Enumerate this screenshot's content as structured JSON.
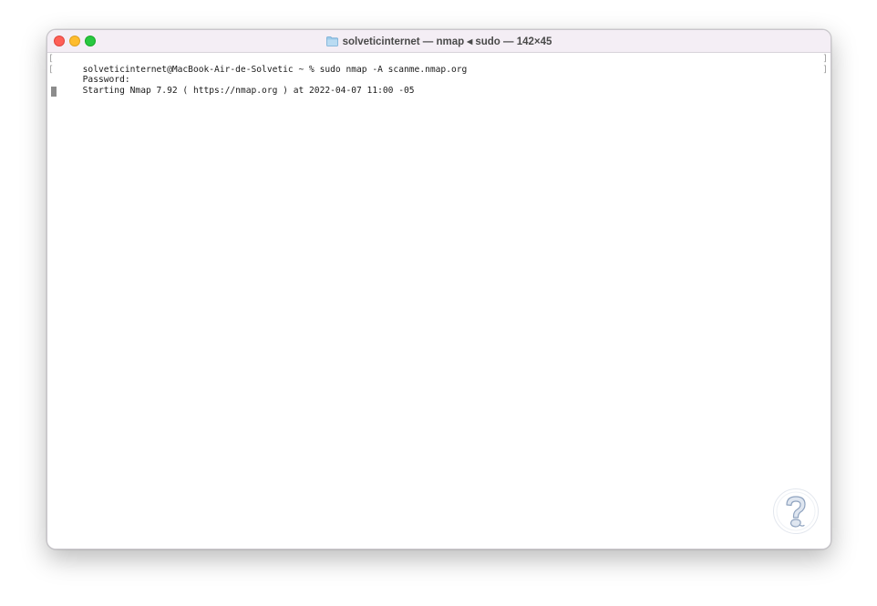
{
  "window": {
    "title": "solveticinternet — nmap ◂ sudo — 142×45"
  },
  "terminal": {
    "lines": [
      "solveticinternet@MacBook-Air-de-Solvetic ~ % sudo nmap -A scanme.nmap.org",
      "Password:",
      "Starting Nmap 7.92 ( https://nmap.org ) at 2022-04-07 11:00 -05"
    ]
  },
  "colors": {
    "close": "#fe5f57",
    "minimize": "#febc2e",
    "zoom": "#28c840",
    "titlebar": "#f4eef5"
  },
  "icons": {
    "folder": "folder-icon",
    "watermark": "solvetic-logo-icon"
  }
}
